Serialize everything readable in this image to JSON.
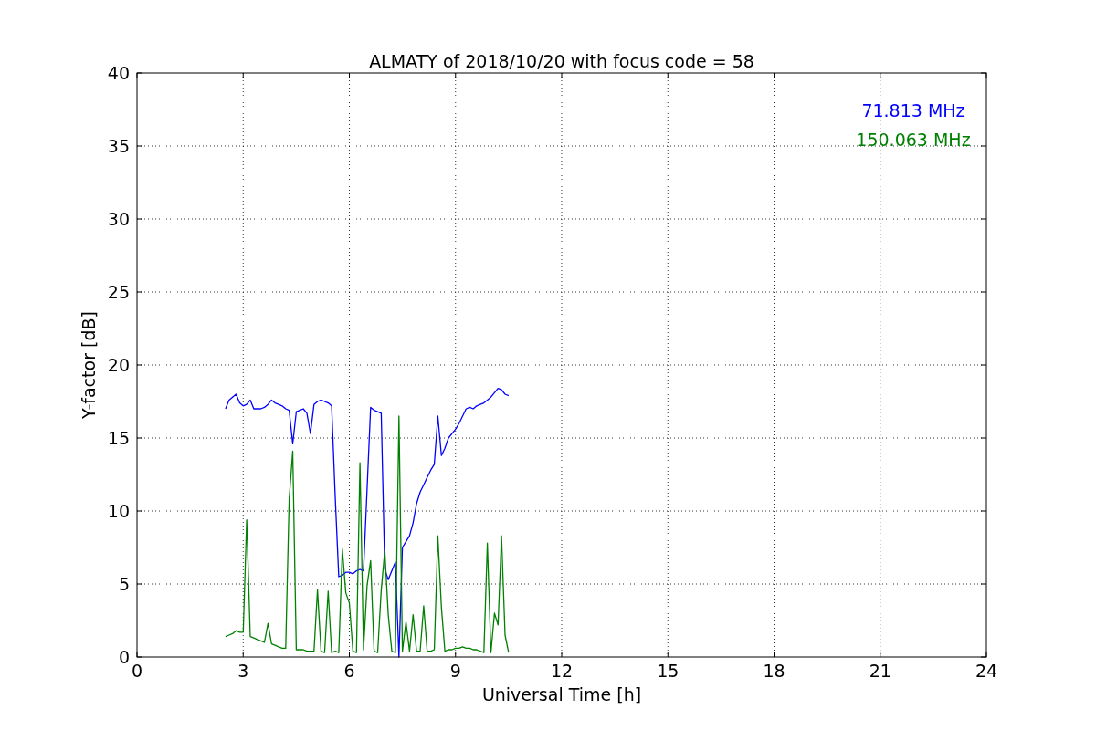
{
  "chart_data": {
    "type": "line",
    "title": "ALMATY of 2018/10/20 with focus code = 58",
    "xlabel": "Universal Time [h]",
    "ylabel": "Y-factor [dB]",
    "grid": true,
    "xlim": [
      0,
      24
    ],
    "ylim": [
      0,
      40
    ],
    "xticks": [
      0,
      3,
      6,
      9,
      12,
      15,
      18,
      21,
      24
    ],
    "yticks": [
      0,
      5,
      10,
      15,
      20,
      25,
      30,
      35,
      40
    ],
    "x": [
      2.5,
      2.6,
      2.7,
      2.8,
      2.9,
      3.0,
      3.1,
      3.2,
      3.3,
      3.4,
      3.5,
      3.6,
      3.7,
      3.8,
      3.9,
      4.0,
      4.1,
      4.2,
      4.3,
      4.4,
      4.5,
      4.6,
      4.7,
      4.8,
      4.9,
      5.0,
      5.1,
      5.2,
      5.3,
      5.4,
      5.5,
      5.6,
      5.7,
      5.8,
      5.9,
      6.0,
      6.1,
      6.2,
      6.3,
      6.4,
      6.5,
      6.6,
      6.7,
      6.8,
      6.9,
      7.0,
      7.1,
      7.2,
      7.3,
      7.4,
      7.5,
      7.6,
      7.7,
      7.8,
      7.9,
      8.0,
      8.1,
      8.2,
      8.3,
      8.4,
      8.5,
      8.6,
      8.7,
      8.8,
      8.9,
      9.0,
      9.1,
      9.2,
      9.3,
      9.4,
      9.5,
      9.6,
      9.7,
      9.8,
      9.9,
      10.0,
      10.1,
      10.2,
      10.3,
      10.4,
      10.5
    ],
    "series": [
      {
        "name": "71.813 MHz",
        "color": "#0000ff",
        "values": [
          17.0,
          17.6,
          17.8,
          18.0,
          17.4,
          17.2,
          17.3,
          17.6,
          17.0,
          17.0,
          17.0,
          17.1,
          17.3,
          17.6,
          17.4,
          17.3,
          17.2,
          17.0,
          16.9,
          14.6,
          16.8,
          16.9,
          17.0,
          16.7,
          15.3,
          17.3,
          17.5,
          17.6,
          17.5,
          17.4,
          17.2,
          11.0,
          5.5,
          5.6,
          5.8,
          5.8,
          5.7,
          5.9,
          6.0,
          5.9,
          11.5,
          17.1,
          16.9,
          16.8,
          16.7,
          6.0,
          5.3,
          5.9,
          6.5,
          0.0,
          7.5,
          7.9,
          8.3,
          9.2,
          10.5,
          11.3,
          11.8,
          12.3,
          12.8,
          13.2,
          16.5,
          13.8,
          14.3,
          15.0,
          15.3,
          15.6,
          16.0,
          16.5,
          17.0,
          17.1,
          17.0,
          17.2,
          17.3,
          17.4,
          17.6,
          17.8,
          18.1,
          18.4,
          18.3,
          18.0,
          17.9
        ]
      },
      {
        "name": "150.063 MHz",
        "color": "#008000",
        "values": [
          1.4,
          1.5,
          1.6,
          1.8,
          1.7,
          1.7,
          9.4,
          1.4,
          1.3,
          1.2,
          1.1,
          1.0,
          2.3,
          0.9,
          0.8,
          0.7,
          0.6,
          0.6,
          10.8,
          14.1,
          0.5,
          0.5,
          0.5,
          0.4,
          0.4,
          0.4,
          4.6,
          0.4,
          0.3,
          4.5,
          0.3,
          0.4,
          0.3,
          7.4,
          4.4,
          3.7,
          0.4,
          0.3,
          13.3,
          0.5,
          4.9,
          6.6,
          0.4,
          0.3,
          4.6,
          7.3,
          2.9,
          0.4,
          0.3,
          16.5,
          0.4,
          2.4,
          0.4,
          2.9,
          0.4,
          0.4,
          3.5,
          0.4,
          0.4,
          0.5,
          8.3,
          3.4,
          0.4,
          0.5,
          0.5,
          0.6,
          0.6,
          0.7,
          0.6,
          0.6,
          0.5,
          0.5,
          0.4,
          0.3,
          7.8,
          0.3,
          3.0,
          2.2,
          8.3,
          1.5,
          0.3
        ]
      }
    ]
  }
}
